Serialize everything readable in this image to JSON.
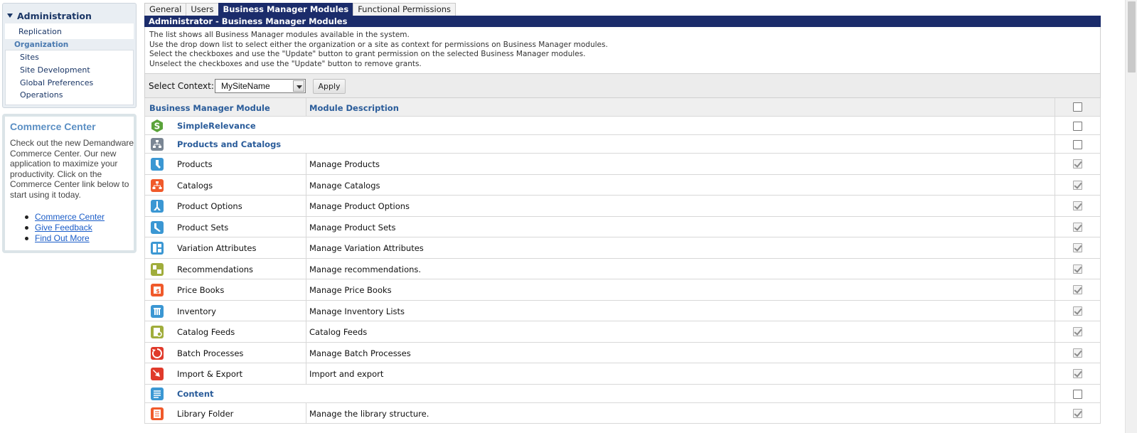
{
  "sidebar": {
    "admin": {
      "title": "Administration",
      "replication": "Replication",
      "org_label": "Organization",
      "items": [
        "Sites",
        "Site Development",
        "Global Preferences",
        "Operations"
      ]
    },
    "commerce": {
      "title": "Commerce Center",
      "text": "Check out the new Demandware Commerce Center. Our new application to maximize your productivity. Click on the Commerce Center link below to start using it today.",
      "links": [
        "Commerce Center",
        "Give Feedback",
        "Find Out More"
      ]
    }
  },
  "tabs": [
    "General",
    "Users",
    "Business Manager Modules",
    "Functional Permissions"
  ],
  "active_tab": "Business Manager Modules",
  "title": "Administrator - Business Manager Modules",
  "info_lines": [
    "The list shows all Business Manager modules available in the system.",
    "Use the drop down list to select either the organization or a site as context for permissions on Business Manager modules.",
    "Select the checkboxes and use the \"Update\" button to grant permission on the selected Business Manager modules.",
    "Unselect the checkboxes and use the \"Update\" button to remove grants."
  ],
  "context": {
    "label": "Select Context:",
    "selected": "MySiteName",
    "apply_label": "Apply"
  },
  "table": {
    "headers": [
      "Business Manager Module",
      "Module Description"
    ],
    "rows": [
      {
        "type": "group",
        "name": "SimpleRelevance",
        "icon": "simplerelevance-icon",
        "checked": false
      },
      {
        "type": "group",
        "name": "Products and Catalogs",
        "icon": "products-catalogs-icon",
        "checked": false
      },
      {
        "type": "item",
        "name": "Products",
        "desc": "Manage Products",
        "icon": "product-icon",
        "checked": true
      },
      {
        "type": "item",
        "name": "Catalogs",
        "desc": "Manage Catalogs",
        "icon": "catalog-icon",
        "checked": true
      },
      {
        "type": "item",
        "name": "Product Options",
        "desc": "Manage Product Options",
        "icon": "product-options-icon",
        "checked": true
      },
      {
        "type": "item",
        "name": "Product Sets",
        "desc": "Manage Product Sets",
        "icon": "product-sets-icon",
        "checked": true
      },
      {
        "type": "item",
        "name": "Variation Attributes",
        "desc": "Manage Variation Attributes",
        "icon": "variation-attributes-icon",
        "checked": true
      },
      {
        "type": "item",
        "name": "Recommendations",
        "desc": "Manage recommendations.",
        "icon": "recommendations-icon",
        "checked": true
      },
      {
        "type": "item",
        "name": "Price Books",
        "desc": "Manage Price Books",
        "icon": "price-books-icon",
        "checked": true
      },
      {
        "type": "item",
        "name": "Inventory",
        "desc": "Manage Inventory Lists",
        "icon": "inventory-icon",
        "checked": true
      },
      {
        "type": "item",
        "name": "Catalog Feeds",
        "desc": "Catalog Feeds",
        "icon": "catalog-feeds-icon",
        "checked": true
      },
      {
        "type": "item",
        "name": "Batch Processes",
        "desc": "Manage Batch Processes",
        "icon": "batch-processes-icon",
        "checked": true
      },
      {
        "type": "item",
        "name": "Import & Export",
        "desc": "Import and export",
        "icon": "import-export-icon",
        "checked": true
      },
      {
        "type": "group",
        "name": "Content",
        "icon": "content-icon",
        "checked": false
      },
      {
        "type": "item",
        "name": "Library Folder",
        "desc": "Manage the library structure.",
        "icon": "library-folder-icon",
        "checked": true
      }
    ]
  },
  "colors": {
    "nav_dark": "#1b2c6b",
    "header_text": "#2a5c9a",
    "link": "#1a5cc8"
  }
}
